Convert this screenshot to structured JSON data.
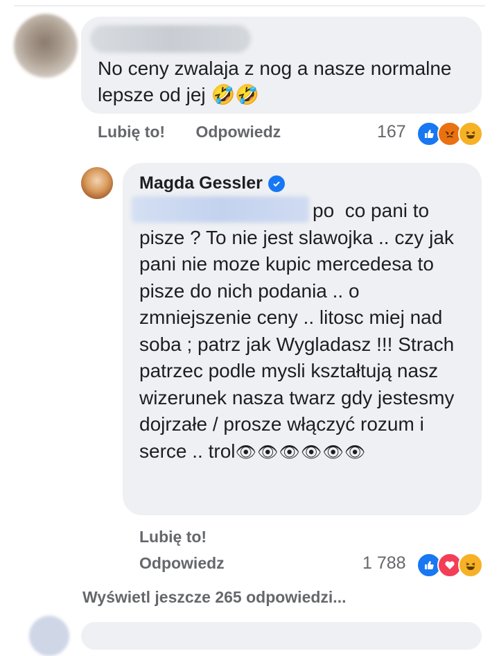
{
  "comment1": {
    "author": "Hidden name",
    "text": "No ceny zwalaja z nog a nasze normalne lepsze od jej",
    "trailing_emoji": "🤣🤣",
    "like_label": "Lubię to!",
    "reply_label": "Odpowiedz",
    "reaction_count": "167",
    "reaction_icons": [
      "like",
      "angry",
      "haha"
    ]
  },
  "comment2": {
    "author": "Magda Gessler",
    "verified": true,
    "mention": "Hidden mention",
    "text": "po  co pani to pisze ? To nie jest slawojka .. czy jak pani nie moze kupic mercedesa to pisze do nich podania .. o zmniejszenie ceny .. litosc miej nad soba ; patrz jak Wygladasz !!! Strach patrzec podle mysli kształtują nasz wizerunek nasza twarz gdy jestesmy dojrzałe / prosze włączyć rozum i serce .. trol",
    "trailing_emoji": "👁👁👁👁👁👁",
    "like_label": "Lubię to!",
    "reply_label": "Odpowiedz",
    "reaction_count": "1 788",
    "reaction_icons": [
      "like",
      "love",
      "haha"
    ]
  },
  "more_replies_label": "Wyświetl jeszcze 265 odpowiedzi...",
  "colors": {
    "bubble": "#eef0f3",
    "muted": "#65676b",
    "like": "#1877f2",
    "angry": "#e9710f",
    "haha": "#f7b125",
    "love": "#f33e58"
  }
}
